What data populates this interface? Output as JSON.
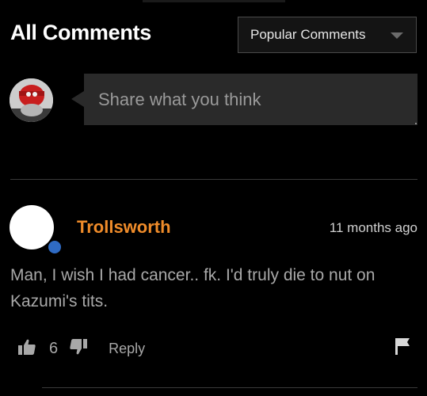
{
  "header": {
    "title": "All Comments",
    "sort_label": "Popular Comments",
    "sort_icon": "chevron-down-icon"
  },
  "composer": {
    "placeholder": "Share what you think"
  },
  "comments": [
    {
      "author": "Trollsworth",
      "author_color": "#f08c2a",
      "time": "11 months ago",
      "text": "Man, I wish I had cancer.. fk. I'd truly die to nut on Kazumi's tits.",
      "votes": "6",
      "reply_label": "Reply",
      "status_color": "#2f6bc4"
    }
  ]
}
